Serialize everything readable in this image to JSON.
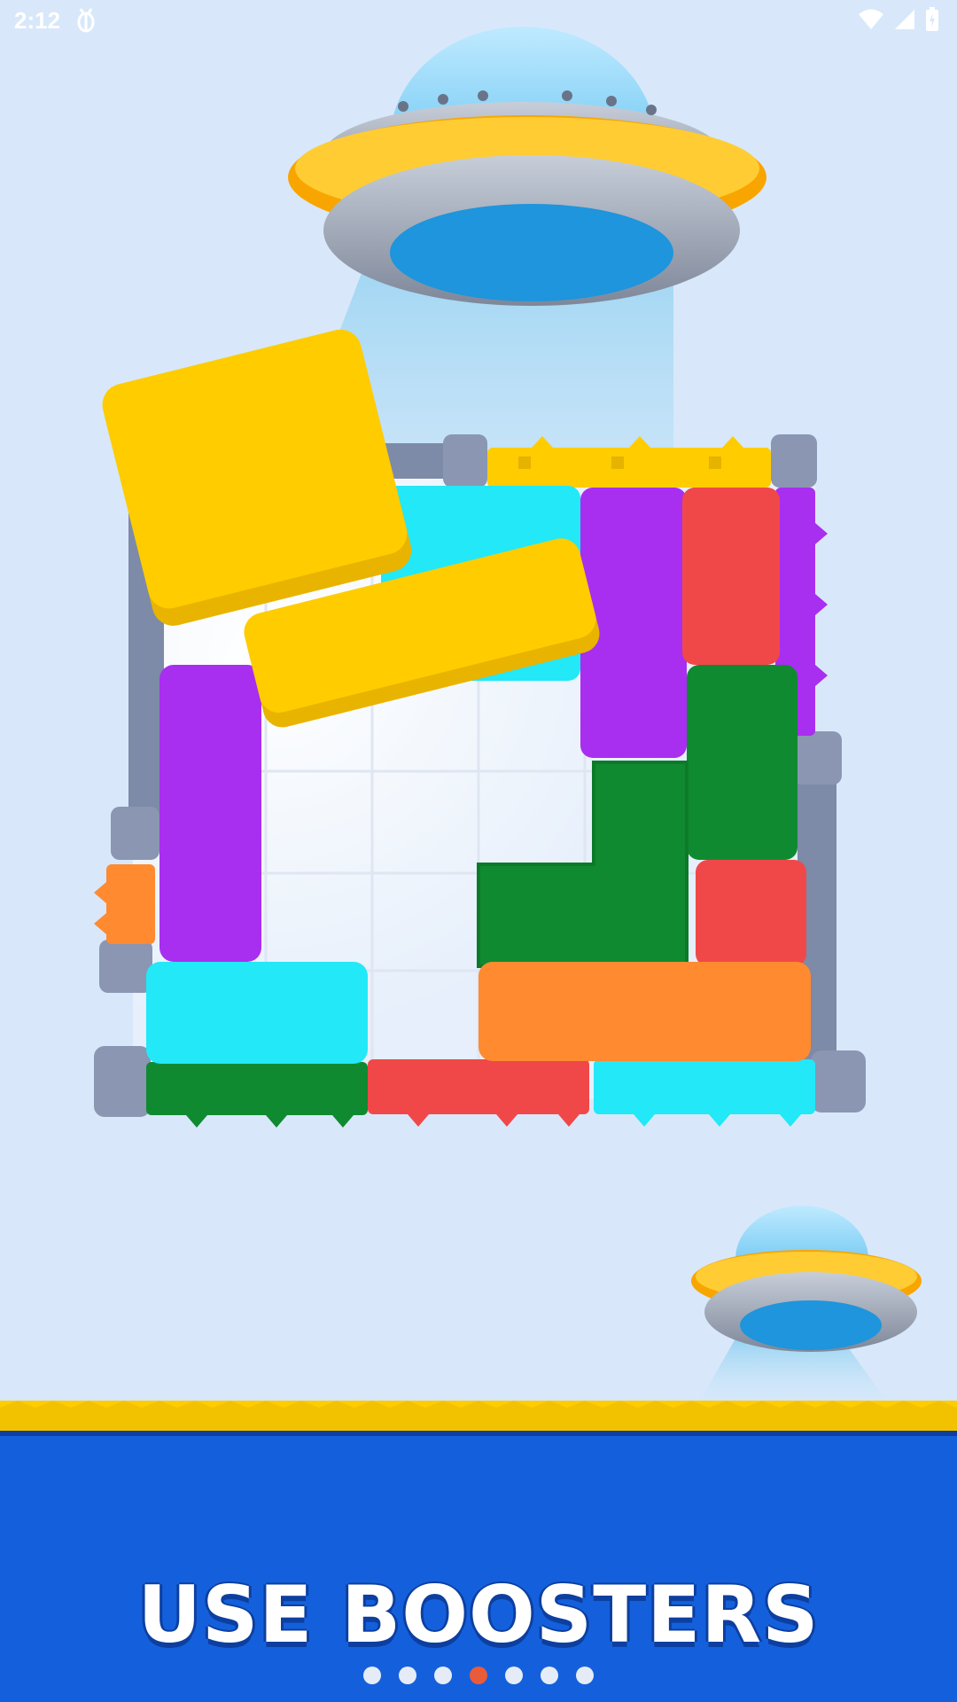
{
  "status_bar": {
    "time": "2:12",
    "notification_icon": "bug-icon",
    "wifi_icon": "wifi-icon",
    "signal_icon": "signal-icon",
    "battery_icon": "battery-icon"
  },
  "banner": {
    "title": "USE BOOSTERS"
  },
  "pager": {
    "total": 7,
    "active_index": 3
  },
  "colors": {
    "background": "#d8e8fa",
    "banner": "#1460dc",
    "yellow": "#ffcc00",
    "cyan": "#22e8f8",
    "purple": "#a82ef0",
    "red": "#f04848",
    "green": "#108a30",
    "orange": "#ff8a30",
    "frame": "#7d8aa8",
    "active_dot": "#ea5b3a"
  }
}
